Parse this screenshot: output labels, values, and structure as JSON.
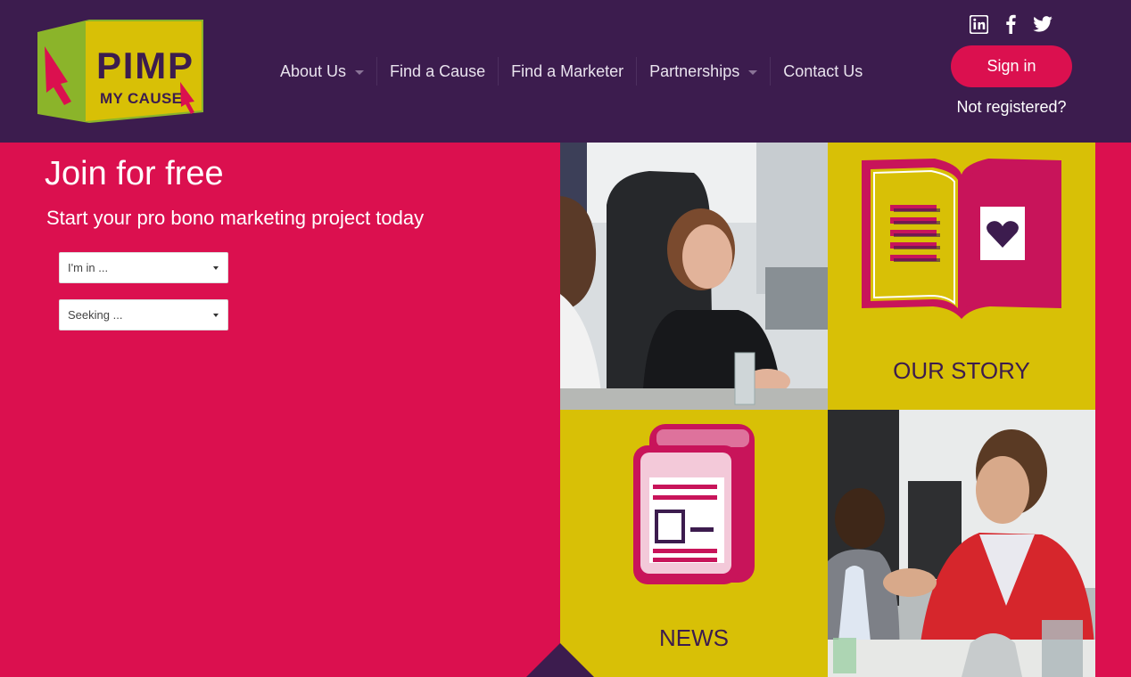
{
  "brand": {
    "logo_line1": "PIMP",
    "logo_line2": "MY CAUSE"
  },
  "nav": {
    "items": [
      {
        "label": "About Us",
        "has_dropdown": true
      },
      {
        "label": "Find a Cause",
        "has_dropdown": false
      },
      {
        "label": "Find a Marketer",
        "has_dropdown": false
      },
      {
        "label": "Partnerships",
        "has_dropdown": true
      },
      {
        "label": "Contact Us",
        "has_dropdown": false
      }
    ]
  },
  "social": {
    "icons": [
      "linkedin-icon",
      "facebook-icon",
      "twitter-icon"
    ]
  },
  "auth": {
    "signin_label": "Sign in",
    "not_registered_label": "Not registered?"
  },
  "hero": {
    "title": "Join for free",
    "subtitle": "Start your pro bono marketing project today",
    "select_role_value": "I'm in ...",
    "select_seeking_value": "Seeking ..."
  },
  "tiles": {
    "our_story_label": "OUR STORY",
    "news_label": "NEWS"
  },
  "colors": {
    "header_bg": "#3c1c4e",
    "accent_pink": "#db104f",
    "accent_yellow": "#d8c006"
  }
}
